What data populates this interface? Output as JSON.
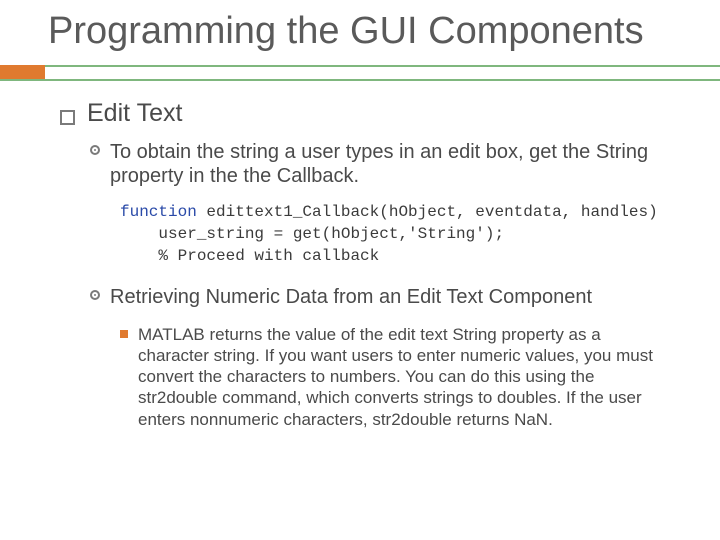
{
  "title": "Programming the GUI Components",
  "section": "Edit Text",
  "para1": "To obtain the string a user types in an edit box, get the String property in the the Callback.",
  "code": {
    "kw": "function",
    "sig": " edittext1_Callback(hObject, eventdata, handles)",
    "l2": "    user_string = get(hObject,'String');",
    "l3": "    % Proceed with callback"
  },
  "subhead": "Retrieving Numeric Data from an Edit Text Component",
  "para2": "MATLAB returns the value of the edit text String property as a character string. If you want users to enter numeric values, you must convert the characters to numbers. You can do this using the str2double command, which converts strings to doubles. If the user enters nonnumeric characters, str2double returns NaN.",
  "colors": {
    "accent": "#e07a2f",
    "rule": "#7fb77e"
  }
}
